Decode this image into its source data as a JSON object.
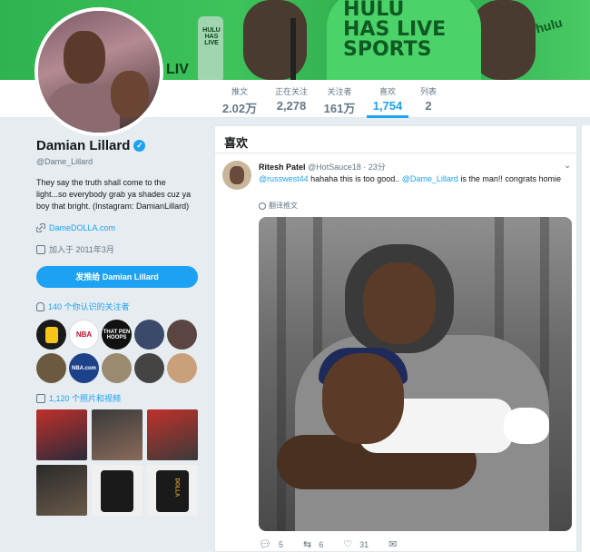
{
  "banner": {
    "shirt_text_1": "HULU",
    "shirt_text_2": "HAS LIVE",
    "shirt_text_3": "SPORTS",
    "bottle_label": "HULU HAS LIVE",
    "partial_text": "LIV",
    "right_text": "hulu"
  },
  "nav": {
    "stats": [
      {
        "label": "推文",
        "value": "2.02万"
      },
      {
        "label": "正在关注",
        "value": "2,278"
      },
      {
        "label": "关注者",
        "value": "161万"
      },
      {
        "label": "喜欢",
        "value": "1,754"
      },
      {
        "label": "列表",
        "value": "2"
      }
    ]
  },
  "profile": {
    "name": "Damian Lillard",
    "verified_glyph": "✓",
    "handle": "@Dame_Lillard",
    "bio": "They say the truth shall come to the light...so everybody grab ya shades cuz ya boy that bright. (Instagram: DamianLillard)",
    "link_icon": "link-icon",
    "link": "DameDOLLA.com",
    "joined": "加入于 2011年3月",
    "tweet_button": "发推给 Damian Lillard",
    "followers_you_know": "140 个你认识的关注者",
    "photos_videos": "1,120 个照片和视频",
    "follower_avatars": [
      "",
      "NBA",
      "THAT PEN HOOPS",
      "",
      "",
      "",
      "NBA.com",
      "",
      "",
      ""
    ],
    "media_labels": [
      "",
      "",
      "",
      "",
      "",
      "DOLLA"
    ]
  },
  "timeline": {
    "title": "喜欢",
    "tweet": {
      "author_name": "Ritesh Patel",
      "author_handle": "@HotSauce18",
      "separator": "·",
      "time": "23分",
      "mention_1": "@russwest44",
      "text_1": " hahaha this is too good.. ",
      "mention_2": "@Dame_Lillard",
      "text_2": " is the man!! congrats homie",
      "translate": "翻译推文",
      "replies": "5",
      "retweets": "6",
      "likes": "31"
    }
  },
  "colors": {
    "accent": "#1da1f2",
    "banner_green": "#3ec25a"
  }
}
